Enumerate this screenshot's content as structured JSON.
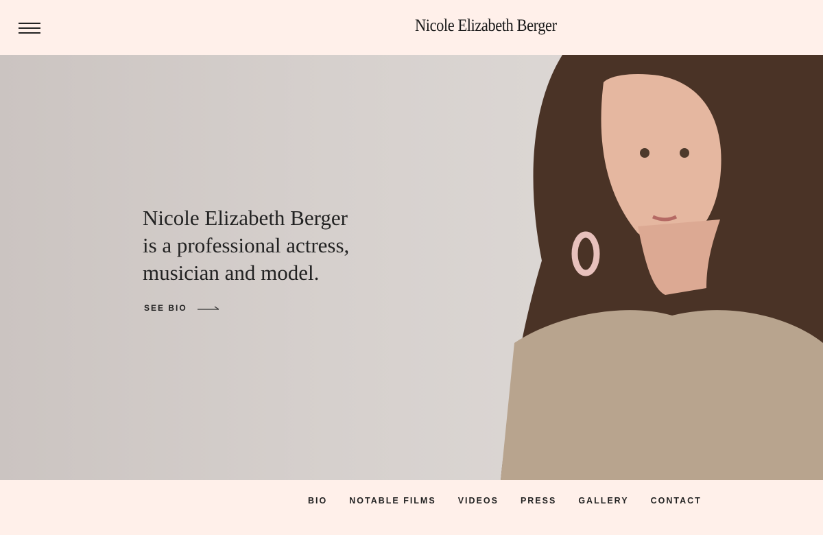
{
  "header": {
    "site_title": "Nicole Elizabeth Berger",
    "menu_icon": "hamburger-icon"
  },
  "hero": {
    "headline_lines": [
      "Nicole Elizabeth Berger",
      "is a professional actress,",
      "musician and model."
    ],
    "cta_label": "SEE BIO",
    "cta_icon": "arrow-right-icon"
  },
  "nav": {
    "items": [
      "BIO",
      "NOTABLE FILMS",
      "VIDEOS",
      "PRESS",
      "GALLERY",
      "CONTACT"
    ]
  }
}
